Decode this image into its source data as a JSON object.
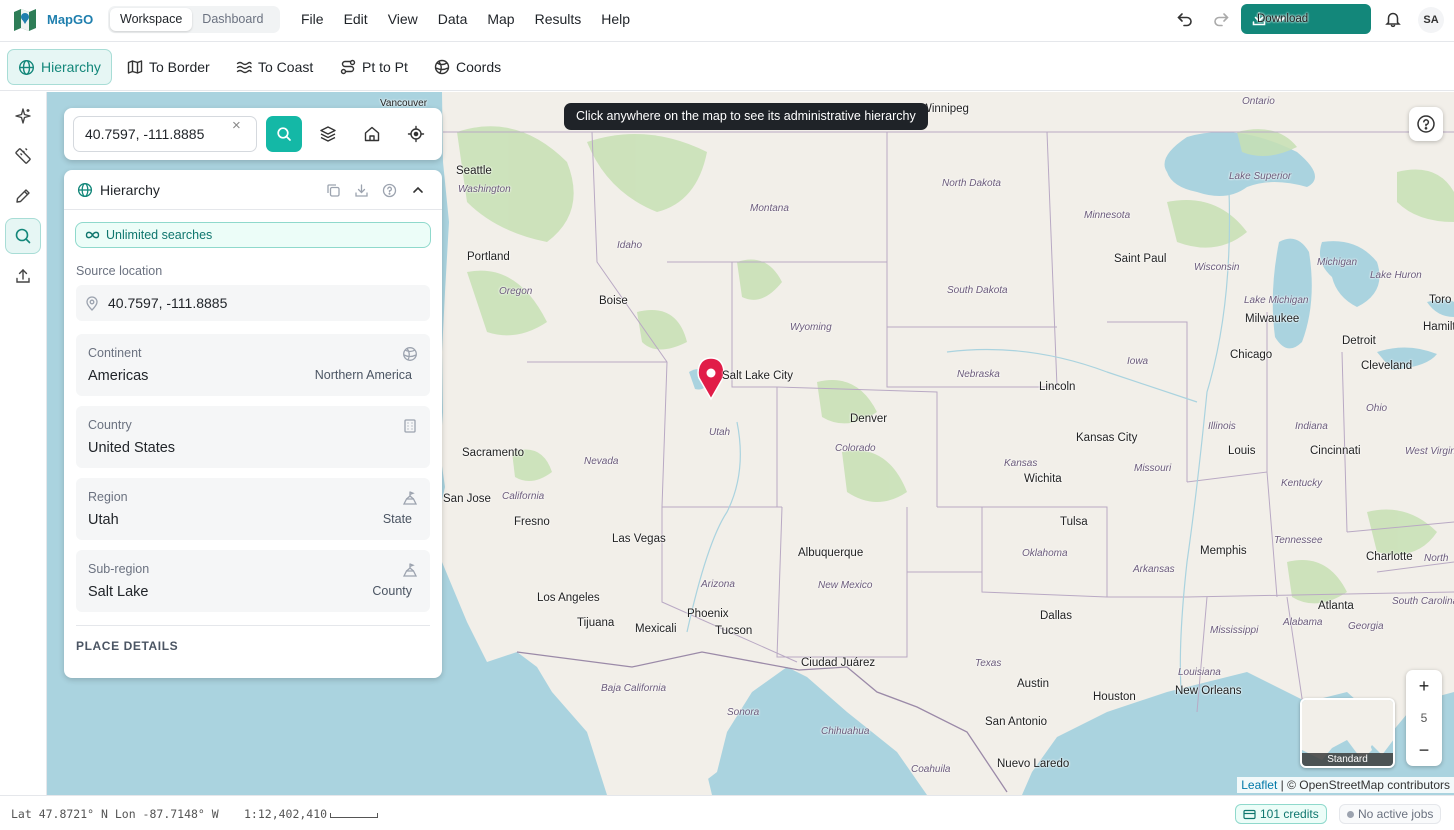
{
  "app": {
    "name": "MapGO",
    "logo_icon": "map-logo-icon"
  },
  "mode_switch": {
    "items": [
      "Workspace",
      "Dashboard"
    ],
    "active": "Workspace"
  },
  "menu": [
    "File",
    "Edit",
    "View",
    "Data",
    "Map",
    "Results",
    "Help"
  ],
  "header_actions": {
    "download_label": "Download",
    "avatar_initials": "SA"
  },
  "tool_tabs": [
    {
      "label": "Hierarchy",
      "icon": "globe-icon",
      "active": true
    },
    {
      "label": "To Border",
      "icon": "map-icon",
      "active": false
    },
    {
      "label": "To Coast",
      "icon": "waves-icon",
      "active": false
    },
    {
      "label": "Pt to Pt",
      "icon": "route-icon",
      "active": false
    },
    {
      "label": "Coords",
      "icon": "globe-grid-icon",
      "active": false
    }
  ],
  "rail": [
    "sparkle-icon",
    "ruler-icon",
    "pencil-icon",
    "search-icon",
    "upload-icon"
  ],
  "search": {
    "value": "40.7597, -111.8885",
    "clear": "×"
  },
  "map": {
    "tooltip": "Click anywhere on the map to see its administrative hierarchy",
    "zoom_level": "5",
    "zoom_in": "+",
    "zoom_out": "−",
    "minimap_label": "Standard",
    "attribution_leaflet": "Leaflet",
    "attribution_osm": "| © OpenStreetMap contributors",
    "cities": [
      "Vancouver",
      "Winnipeg",
      "Ontario",
      "Seattle",
      "Portland",
      "Boise",
      "Salt Lake City",
      "Denver",
      "Sacramento",
      "Fresno",
      "San Jose",
      "Las Vegas",
      "Los Angeles",
      "Tijuana",
      "Mexicali",
      "Phoenix",
      "Tucson",
      "Albuquerque",
      "Ciudad Juárez",
      "Lincoln",
      "Kansas City",
      "Wichita",
      "Tulsa",
      "Dallas",
      "Austin",
      "San Antonio",
      "Houston",
      "Nuevo Laredo",
      "New Orleans",
      "Memphis",
      "Atlanta",
      "Charlotte",
      "Saint Paul",
      "Milwaukee",
      "Chicago",
      "Detroit",
      "Cleveland",
      "Cincinnati",
      "Louis",
      "Toro",
      "Hamilto"
    ],
    "states": [
      "Washington",
      "Montana",
      "North Dakota",
      "Idaho",
      "Oregon",
      "South Dakota",
      "Wyoming",
      "Minnesota",
      "Wisconsin",
      "Michigan",
      "Nebraska",
      "Iowa",
      "Nevada",
      "Utah",
      "Colorado",
      "Kansas",
      "Missouri",
      "Illinois",
      "Indiana",
      "Ohio",
      "California",
      "Arizona",
      "New Mexico",
      "Oklahoma",
      "Arkansas",
      "Tennessee",
      "Kentucky",
      "Texas",
      "Louisiana",
      "Mississippi",
      "Alabama",
      "Georgia",
      "South Carolina",
      "North",
      "West Virginia",
      "Lake Superior",
      "Lake Huron",
      "Lake Michigan",
      "Baja California",
      "Sonora",
      "Chihuahua",
      "Coahuila"
    ]
  },
  "panel": {
    "title": "Hierarchy",
    "unlimited": "Unlimited searches",
    "source_label": "Source location",
    "source_value": "40.7597, -111.8885",
    "rows": [
      {
        "key": "Continent",
        "value": "Americas",
        "tag": "Northern America",
        "icon": "globe-outline-icon"
      },
      {
        "key": "Country",
        "value": "United States",
        "tag": "",
        "icon": "building-icon"
      },
      {
        "key": "Region",
        "value": "Utah",
        "tag": "State",
        "icon": "landmark-icon"
      },
      {
        "key": "Sub-region",
        "value": "Salt Lake",
        "tag": "County",
        "icon": "landmark-icon"
      }
    ],
    "place_details": "PLACE DETAILS"
  },
  "status": {
    "coords": "Lat 47.8721° N Lon -87.7148° W",
    "scale": "1:12,402,410",
    "credits": "101 credits",
    "jobs": "No active jobs"
  },
  "colors": {
    "accent": "#13877a",
    "accent_light": "#14b8a6",
    "pin": "#e11d48"
  }
}
